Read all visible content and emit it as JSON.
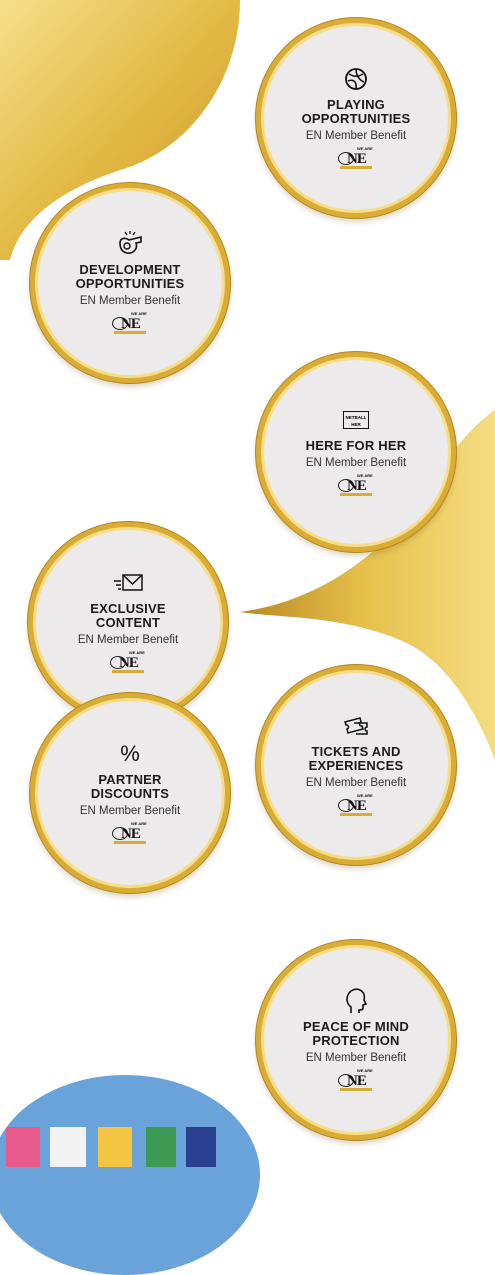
{
  "colors": {
    "gold": "#d9ac35",
    "gold_light": "#f6dd86",
    "badge_bg": "#eceaeb",
    "sky": "#6aa2da"
  },
  "badges": [
    {
      "icon": "netball-icon",
      "title_lines": [
        "PLAYING",
        "OPPORTUNITIES"
      ],
      "sub": "EN Member Benefit"
    },
    {
      "icon": "whistle-icon",
      "title_lines": [
        "DEVELOPMENT",
        "OPPORTUNITIES"
      ],
      "sub": "EN Member Benefit"
    },
    {
      "icon": "netball-her-laptop-icon",
      "icon_text": "NETBALL HER",
      "title_lines": [
        "HERE FOR HER"
      ],
      "sub": "EN Member Benefit"
    },
    {
      "icon": "envelope-icon",
      "title_lines": [
        "EXCLUSIVE",
        "CONTENT"
      ],
      "sub": "EN Member Benefit"
    },
    {
      "icon": "ticket-icon",
      "title_lines": [
        "TICKETS AND",
        "EXPERIENCES"
      ],
      "sub": "EN Member Benefit"
    },
    {
      "icon": "percent-icon",
      "icon_text": "%",
      "title_lines": [
        "PARTNER",
        "DISCOUNTS"
      ],
      "sub": "EN Member Benefit"
    },
    {
      "icon": "head-profile-icon",
      "title_lines": [
        "PEACE OF MIND",
        "PROTECTION"
      ],
      "sub": "EN Member Benefit"
    }
  ],
  "logo": {
    "o": "O",
    "ne": "NE",
    "we_are": "WE ARE"
  }
}
